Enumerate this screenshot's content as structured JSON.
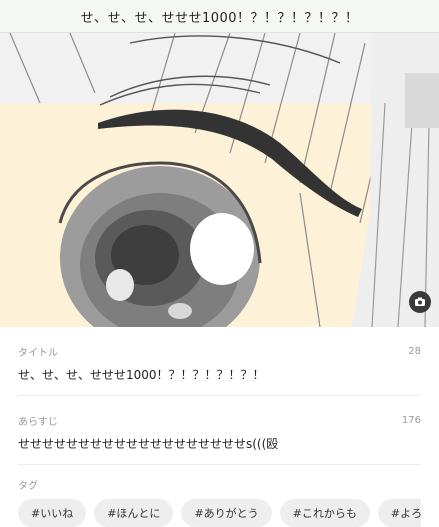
{
  "header": {
    "title": "せ、せ、せ、せせせ1000！？！？！？！？！"
  },
  "cover": {
    "camera_icon": "camera-icon"
  },
  "title_field": {
    "label": "タイトル",
    "count": "28",
    "value": "せ、せ、せ、せせせ1000！？！？！？！？！"
  },
  "synopsis_field": {
    "label": "あらすじ",
    "count": "176",
    "value": "せせせせせせせせせせせせせせせせせせせs(((殴"
  },
  "tags_field": {
    "label": "タグ",
    "items": [
      "#いいね",
      "#ほんとに",
      "#ありがとう",
      "#これからも",
      "#よろしくね"
    ]
  }
}
